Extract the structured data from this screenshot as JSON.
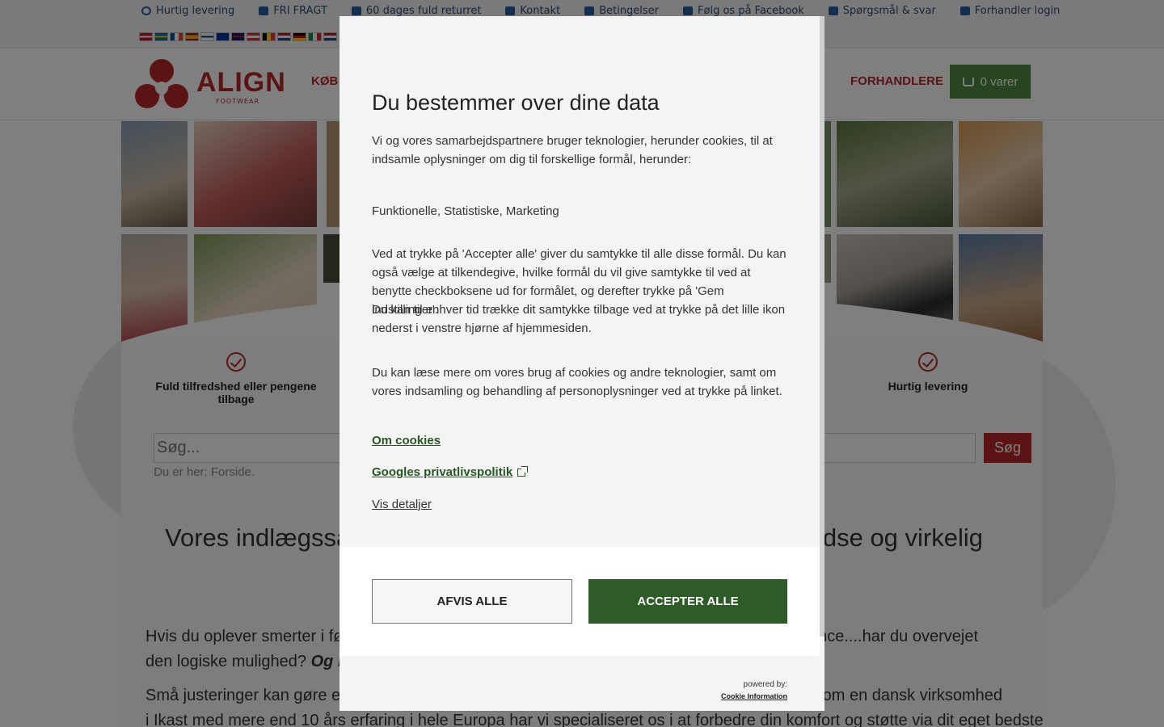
{
  "topbar": {
    "links": [
      {
        "label": "Hurtig levering",
        "icon": "clock-icon"
      },
      {
        "label": "FRI FRAGT",
        "icon": "truck-icon"
      },
      {
        "label": "60 dages fuld returret",
        "icon": "exchange-icon"
      },
      {
        "label": "Kontakt",
        "icon": "phone-icon"
      },
      {
        "label": "Betingelser",
        "icon": "document-icon"
      },
      {
        "label": "Følg os på Facebook",
        "icon": "facebook-icon"
      },
      {
        "label": "Spørgsmål & svar",
        "icon": "users-icon"
      },
      {
        "label": "Forhandler login",
        "icon": "login-icon"
      }
    ],
    "flags": [
      "dk",
      "se",
      "fr",
      "es",
      "fi",
      "eu",
      "gb",
      "at",
      "be",
      "nl",
      "de",
      "it",
      "nl2"
    ]
  },
  "nav": {
    "logo_text": "ALIGN",
    "logo_sub": "FOOTWEAR",
    "buy": "KØB",
    "dealers": "FORHANDLERE",
    "cart": "0 varer"
  },
  "benefits": {
    "left": "Fuld tilfredshed eller pengene tilbage",
    "right": "Hurtig levering"
  },
  "search": {
    "placeholder": "Søg...",
    "button": "Søg"
  },
  "breadcrumb": "Du er her: Forside.",
  "article": {
    "heading_left": "Vores indlægssål",
    "heading_right": "dse og virkelig",
    "p1_left": "Hvis du oplever smerter i fød",
    "p1_right": "ance....har du overvejet",
    "p1_line2": "den logiske mulighed?",
    "p1_line2_em": "Og har",
    "p2_left": "Små justeringer kan gøre en",
    "p2_right": "Som en dansk virksomhed",
    "p2_line2": "i Ikast med mere end 10 års erfaring i hele Europa har vi specialiseret os i at forbedre din komfort og støtte via dit eget bedste"
  },
  "consent": {
    "title": "Du bestemmer over dine data",
    "intro": "Vi og vores samarbejdspartnere bruger teknologier, herunder cookies, til at indsamle oplysninger om dig til forskellige formål, herunder:",
    "purposes": "Funktionelle, Statistiske, Marketing",
    "explain1": "Ved at trykke på 'Accepter alle' giver du samtykke til alle disse formål. Du kan også vælge at tilkendegive, hvilke formål du vil give samtykke til ved at benytte checkboksene ud for formålet, og derefter trykke på 'Gem indstillinger'.",
    "explain2": "Du kan til enhver tid trække dit samtykke tilbage ved at trykke på det lille ikon nederst i venstre hjørne af hjemmesiden.",
    "readmore": "Du kan læse mere om vores brug af cookies og andre teknologier, samt om vores indsamling og behandling af personoplysninger ved at trykke på linket.",
    "link_cookies": "Om cookies",
    "link_google": "Googles privatlivspolitik",
    "details": "Vis detaljer",
    "reject": "AFVIS ALLE",
    "accept": "ACCEPTER ALLE",
    "powered_by": "powered by:",
    "provider": "Cookie Information"
  },
  "colors": {
    "brand_red": "#b82727",
    "cart_green": "#4e8a3e",
    "accept_green": "#2f5b29",
    "link_green": "#2a5625",
    "topbar_blue": "#2b5a9c"
  }
}
